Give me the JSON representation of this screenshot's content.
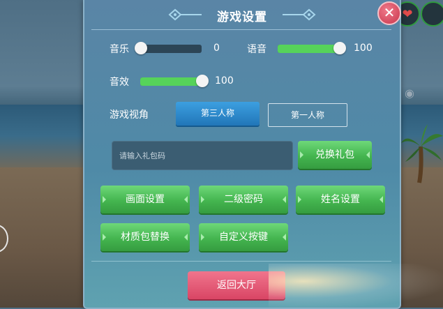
{
  "title": "游戏设置",
  "close_label": "✕",
  "audio": {
    "music": {
      "label": "音乐",
      "value": "0"
    },
    "voice": {
      "label": "语音",
      "value": "100"
    },
    "sfx": {
      "label": "音效",
      "value": "100"
    }
  },
  "view": {
    "label": "游戏视角",
    "options": [
      "第三人称",
      "第一人称"
    ],
    "selected": "第三人称"
  },
  "gift": {
    "placeholder": "请输入礼包码",
    "redeem_label": "兑换礼包"
  },
  "buttons": {
    "graphics": "画面设置",
    "password": "二级密码",
    "name": "姓名设置",
    "texture": "材质包替换",
    "keys": "自定义按键"
  },
  "return_label": "返回大厅",
  "colors": {
    "accent_green": "#44b54f",
    "accent_blue": "#2176b8",
    "accent_red": "#d94565"
  }
}
